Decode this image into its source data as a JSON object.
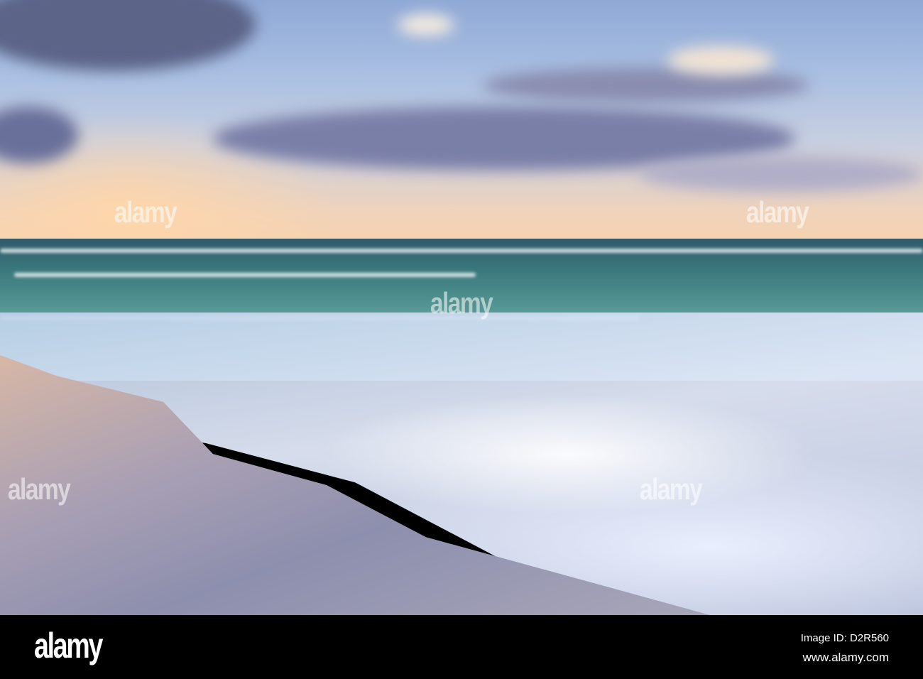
{
  "photo": {
    "subject": "beach-waves-sunset",
    "colors": {
      "sky": "#a9bfe2",
      "horizon": "#f6d2b0",
      "sea": "#3d7c80",
      "foam": "#e1e8f8",
      "sand": "#a89fb4"
    }
  },
  "watermark": {
    "text": "alamy"
  },
  "footer": {
    "logo": "alamy",
    "image_id": "Image ID: D2R560",
    "url": "www.alamy.com"
  }
}
